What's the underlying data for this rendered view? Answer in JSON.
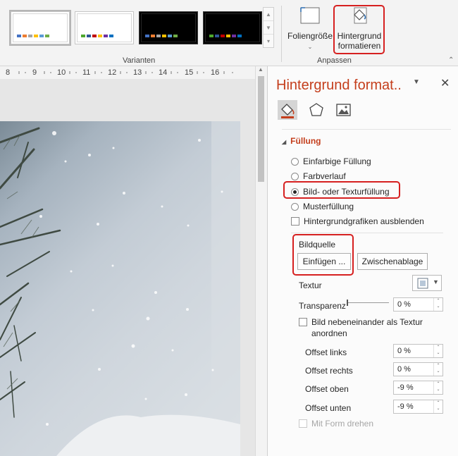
{
  "ribbon": {
    "groups": {
      "variants_label": "Varianten",
      "customize_label": "Anpassen"
    },
    "variants": [
      {
        "name": "variant-1",
        "theme": "light",
        "swatches": [
          "#4472c4",
          "#ed7d31",
          "#a5a5a5",
          "#ffc000",
          "#5b9bd5",
          "#70ad47"
        ]
      },
      {
        "name": "variant-2",
        "theme": "light",
        "swatches": [
          "#4ea72e",
          "#2f5597",
          "#c00000",
          "#ffc000",
          "#7030a0",
          "#0070c0"
        ]
      },
      {
        "name": "variant-3",
        "theme": "dark",
        "swatches": [
          "#4472c4",
          "#ed7d31",
          "#a5a5a5",
          "#ffc000",
          "#5b9bd5",
          "#70ad47"
        ]
      },
      {
        "name": "variant-4",
        "theme": "dark",
        "swatches": [
          "#4ea72e",
          "#2f5597",
          "#c00000",
          "#ffc000",
          "#7030a0",
          "#0070c0"
        ]
      }
    ],
    "slide_size_label": "Foliengröße",
    "format_background_label_1": "Hintergrund",
    "format_background_label_2": "formatieren"
  },
  "ruler": {
    "marks": [
      "8",
      "9",
      "10",
      "11",
      "12",
      "13",
      "14",
      "15",
      "16"
    ]
  },
  "pane": {
    "title": "Hintergrund format..",
    "icons": [
      "fill-icon",
      "effects-icon",
      "picture-icon"
    ],
    "section_title": "Füllung",
    "fill_options": [
      {
        "label": "Einfarbige Füllung",
        "checked": false
      },
      {
        "label": "Farbverlauf",
        "checked": false
      },
      {
        "label": "Bild- oder Texturfüllung",
        "checked": true
      },
      {
        "label": "Musterfüllung",
        "checked": false
      }
    ],
    "hide_background_graphics": "Hintergrundgrafiken ausblenden",
    "picture_source_label": "Bildquelle",
    "insert_button": "Einfügen ...",
    "clipboard_button": "Zwischenablage",
    "texture_label": "Textur",
    "transparency_label": "Transparenz",
    "transparency_value": "0 %",
    "tile_label_line1": "Bild nebeneinander als Textur",
    "tile_label_line2": "anordnen",
    "offsets": [
      {
        "label": "Offset links",
        "value": "0 %"
      },
      {
        "label": "Offset rechts",
        "value": "0 %"
      },
      {
        "label": "Offset oben",
        "value": "-9 %"
      },
      {
        "label": "Offset unten",
        "value": "-9 %"
      }
    ],
    "rotate_with_shape": "Mit Form drehen",
    "accent_color": "#c43e1c",
    "highlight_color": "#d62020"
  }
}
